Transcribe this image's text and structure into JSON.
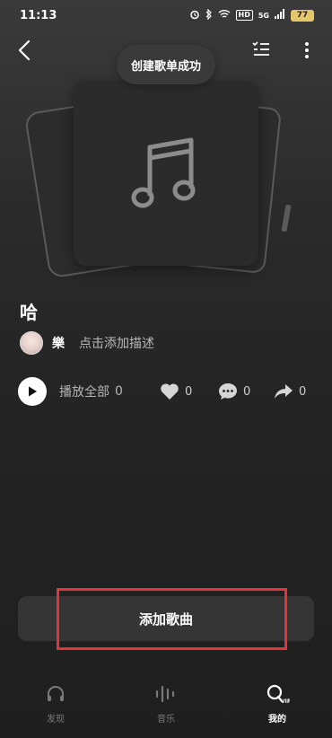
{
  "status_bar": {
    "time": "11:13",
    "network": "5G",
    "battery": "77"
  },
  "toast": {
    "text": "创建歌单成功"
  },
  "playlist": {
    "title": "哈",
    "owner_name": "樂",
    "description_placeholder": "点击添加描述"
  },
  "actions": {
    "play_all_label": "播放全部",
    "play_all_count": "0",
    "like_count": "0",
    "comment_count": "0",
    "share_count": "0"
  },
  "add_song_button": {
    "label": "添加歌曲"
  },
  "tabbar": {
    "tabs": [
      {
        "label": "发现",
        "icon": "headphones-icon",
        "active": false
      },
      {
        "label": "音乐",
        "icon": "waveform-icon",
        "active": false
      },
      {
        "label": "我的",
        "icon": "profile-vip-icon",
        "active": true
      }
    ]
  },
  "colors": {
    "highlight": "#e0363a",
    "battery": "#e6c66b",
    "button_bg": "#353535"
  }
}
